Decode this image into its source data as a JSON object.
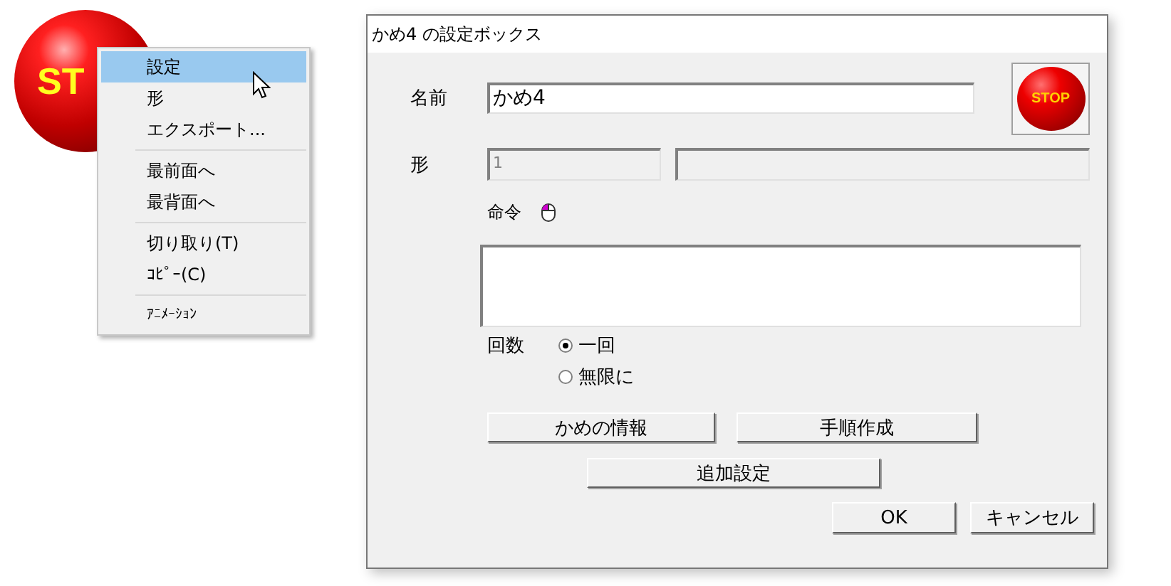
{
  "stop_ball": {
    "label": "ST"
  },
  "context_menu": {
    "items": [
      {
        "kind": "item",
        "label": "設定",
        "selected": true
      },
      {
        "kind": "item",
        "label": "形",
        "selected": false
      },
      {
        "kind": "item",
        "label": "エクスポート...",
        "selected": false
      },
      {
        "kind": "separator"
      },
      {
        "kind": "item",
        "label": "最前面へ",
        "selected": false
      },
      {
        "kind": "item",
        "label": "最背面へ",
        "selected": false
      },
      {
        "kind": "separator"
      },
      {
        "kind": "item",
        "label": "切り取り(T)",
        "selected": false
      },
      {
        "kind": "item",
        "label": "ｺﾋﾟｰ(C)",
        "selected": false
      },
      {
        "kind": "separator"
      },
      {
        "kind": "small",
        "label": "ｱﾆﾒｰｼｮﾝ",
        "selected": false
      }
    ]
  },
  "dialog": {
    "title": "かめ4 の設定ボックス",
    "icon": {
      "label": "STOP"
    },
    "name": {
      "label": "名前",
      "value": "かめ4"
    },
    "shape": {
      "label": "形",
      "value": "1",
      "disabled": true
    },
    "command": {
      "label": "命令"
    },
    "count": {
      "label": "回数",
      "options": [
        {
          "label": "一回",
          "selected": true
        },
        {
          "label": "無限に",
          "selected": false
        }
      ]
    },
    "button_rows": [
      [
        "かめの情報",
        "手順作成"
      ],
      [
        "追加設定"
      ]
    ],
    "footer_buttons": [
      "OK",
      "キャンセル"
    ]
  }
}
